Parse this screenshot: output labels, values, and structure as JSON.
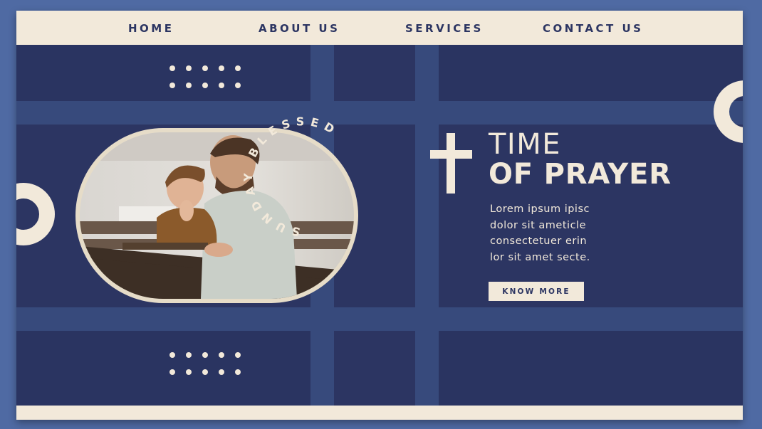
{
  "nav": {
    "items": [
      {
        "label": "HOME"
      },
      {
        "label": "ABOUT US"
      },
      {
        "label": "SERVICES"
      },
      {
        "label": "CONTACT US"
      }
    ]
  },
  "hero": {
    "circular_text": "SUNDAY BLESSED",
    "title_line1": "TIME",
    "title_line2": "OF PRAYER",
    "body": "Lorem ipsum ipisc\ndolor sit ameticle\nconsectetuer erin\nlor sit amet secte.",
    "button_label": "KNOW MORE"
  },
  "colors": {
    "outer_background": "#4f6aa3",
    "primary_navy": "#2c3562",
    "cream": "#f2e9da",
    "accent_blue": "#374a7c"
  },
  "icons": {
    "cross": "cross-icon",
    "dots": "dot-grid-icon",
    "rings": "ring-decoration-icon"
  }
}
